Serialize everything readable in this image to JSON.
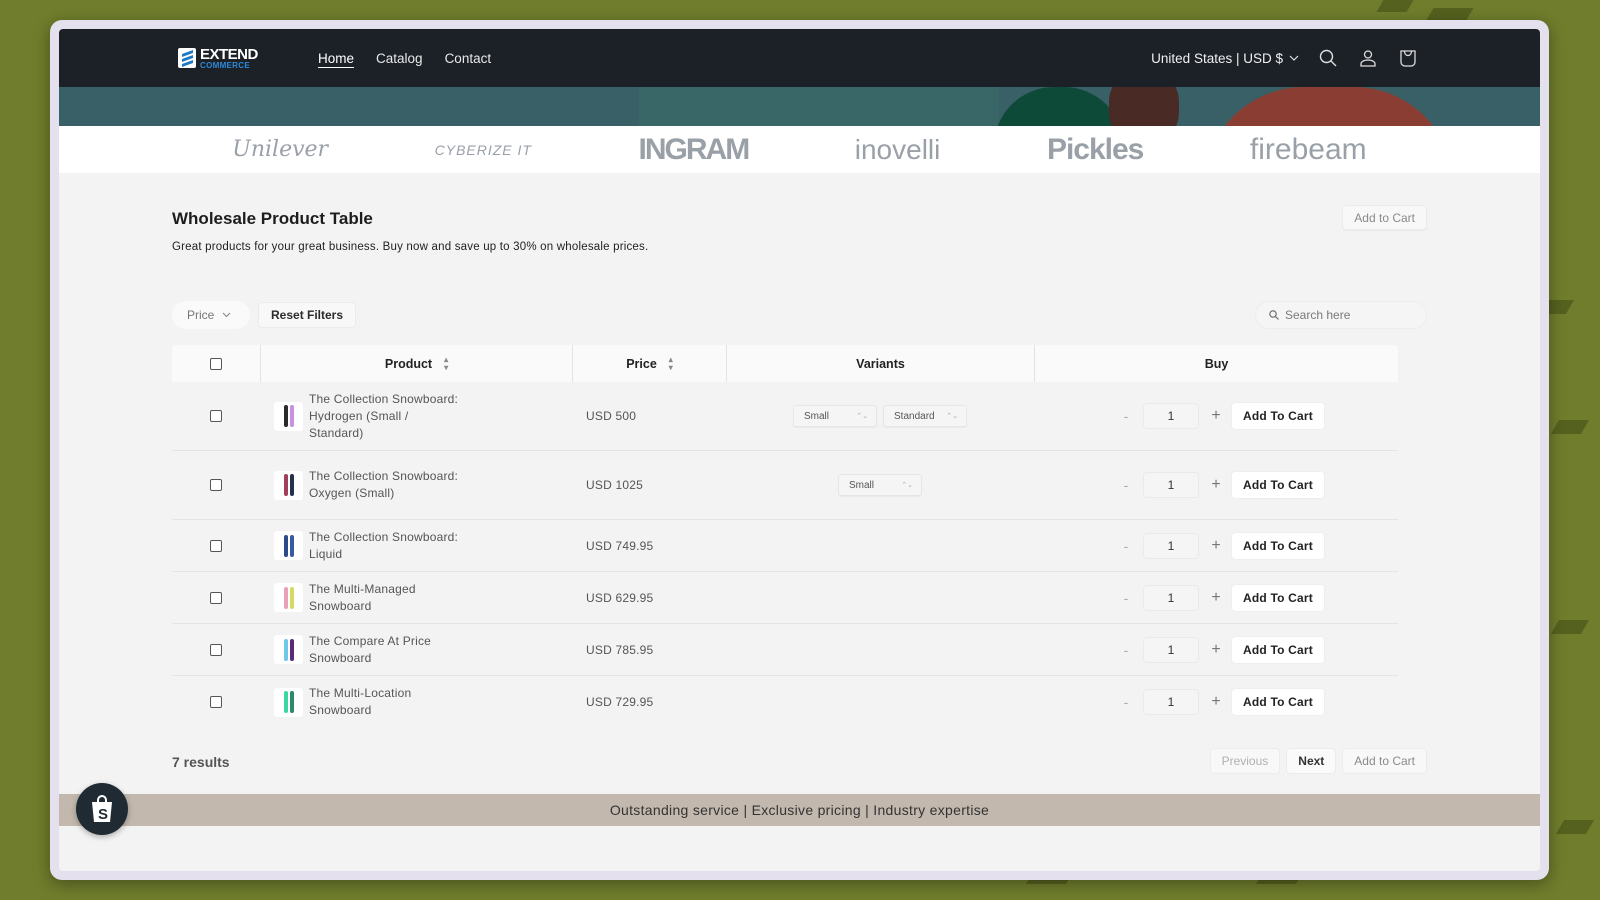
{
  "header": {
    "logo": {
      "line1": "EXTEND",
      "line2": "COMMERCE"
    },
    "nav": [
      {
        "label": "Home",
        "active": true
      },
      {
        "label": "Catalog",
        "active": false
      },
      {
        "label": "Contact",
        "active": false
      }
    ],
    "locale": "United States | USD $",
    "icons": [
      "search-icon",
      "account-icon",
      "cart-icon"
    ]
  },
  "brands": [
    "Unilever",
    "CYBERIZE IT",
    "INGRAM",
    "inovelli",
    "Pickles",
    "firebeam"
  ],
  "main": {
    "title": "Wholesale Product Table",
    "subtitle": "Great products for your great business. Buy now and save up to 30% on wholesale prices.",
    "top_add_to_cart": "Add to Cart",
    "filters": {
      "price_label": "Price",
      "reset_label": "Reset Filters"
    },
    "search": {
      "placeholder": "Search here",
      "value": ""
    },
    "table": {
      "columns": [
        "Product",
        "Price",
        "Variants",
        "Buy"
      ],
      "rows": [
        {
          "name": "The Collection Snowboard: Hydrogen (Small / Standard)",
          "price": "USD 500",
          "variants": [
            "Small",
            "Standard"
          ],
          "qty": "1",
          "buy_label": "Add To Cart",
          "colors": [
            "#2a2a2a",
            "#c790e0"
          ]
        },
        {
          "name": "The Collection Snowboard: Oxygen (Small)",
          "price": "USD 1025",
          "variants": [
            "Small"
          ],
          "qty": "1",
          "buy_label": "Add To Cart",
          "colors": [
            "#a0405a",
            "#24324c"
          ]
        },
        {
          "name": "The Collection Snowboard: Liquid",
          "price": "USD 749.95",
          "variants": [],
          "qty": "1",
          "buy_label": "Add To Cart",
          "colors": [
            "#2a4a8a",
            "#3a5aa0"
          ]
        },
        {
          "name": "The Multi-Managed Snowboard",
          "price": "USD 629.95",
          "variants": [],
          "qty": "1",
          "buy_label": "Add To Cart",
          "colors": [
            "#e8a0b8",
            "#d8d860"
          ]
        },
        {
          "name": "The Compare At Price Snowboard",
          "price": "USD 785.95",
          "variants": [],
          "qty": "1",
          "buy_label": "Add To Cart",
          "colors": [
            "#6ec8e8",
            "#5a2a7a"
          ]
        },
        {
          "name": "The Multi-Location Snowboard",
          "price": "USD 729.95",
          "variants": [],
          "qty": "1",
          "buy_label": "Add To Cart",
          "colors": [
            "#3ad8a0",
            "#2a8a6a"
          ]
        }
      ]
    },
    "results": "7 results",
    "pager": {
      "previous": "Previous",
      "next": "Next",
      "add_to_cart": "Add to Cart"
    }
  },
  "footer": {
    "tagline": "Outstanding service | Exclusive pricing | Industry expertise"
  }
}
